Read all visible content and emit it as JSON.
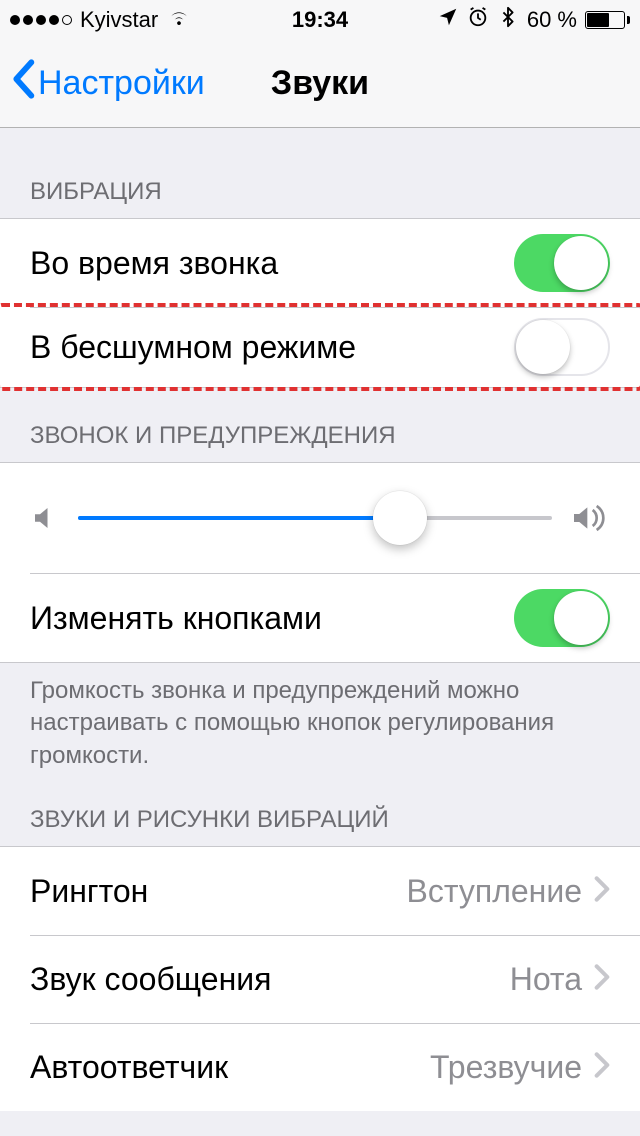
{
  "status": {
    "carrier": "Kyivstar",
    "time": "19:34",
    "battery_percent_text": "60 %",
    "battery_percent": 60,
    "signal_filled": 4
  },
  "nav": {
    "back_label": "Настройки",
    "title": "Звуки"
  },
  "sections": {
    "vibration_header": "ВИБРАЦИЯ",
    "ringer_header": "ЗВОНОК И ПРЕДУПРЕЖДЕНИЯ",
    "patterns_header": "ЗВУКИ И РИСУНКИ ВИБРАЦИЙ"
  },
  "vibration": {
    "on_ring_label": "Во время звонка",
    "on_ring_on": true,
    "on_silent_label": "В бесшумном режиме",
    "on_silent_on": false
  },
  "ringer": {
    "slider_percent": 68,
    "change_with_buttons_label": "Изменять кнопками",
    "change_with_buttons_on": true,
    "footer": "Громкость звонка и предупреждений можно настраивать с помощью кнопок регулирования громкости."
  },
  "sound_rows": {
    "ringtone_label": "Рингтон",
    "ringtone_value": "Вступление",
    "text_tone_label": "Звук сообщения",
    "text_tone_value": "Нота",
    "voicemail_label": "Автоответчик",
    "voicemail_value": "Трезвучие"
  },
  "icons": {
    "back_chevron": "chevron-left",
    "disclosure": "chevron-right",
    "location": "location-arrow",
    "alarm": "alarm-clock",
    "bluetooth": "bluetooth",
    "speaker_low": "speaker-low",
    "speaker_high": "speaker-high"
  }
}
